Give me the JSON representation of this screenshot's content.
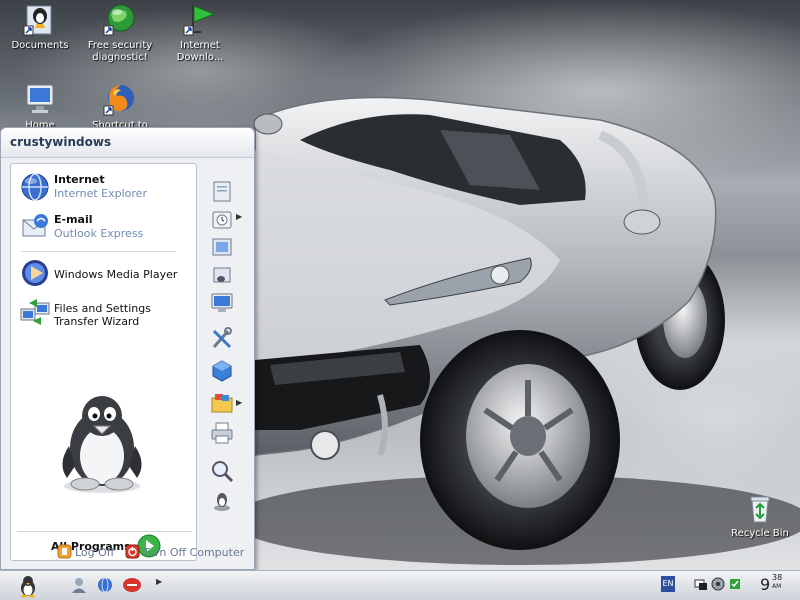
{
  "desktop": {
    "icons": [
      {
        "label": "Documents",
        "icon": "documents-icon"
      },
      {
        "label": "Free security diagnostic!",
        "icon": "security-globe-icon"
      },
      {
        "label": "Internet Downlo...",
        "icon": "download-flag-icon"
      },
      {
        "label": "Home",
        "icon": "computer-monitor-icon"
      },
      {
        "label": "Shortcut to",
        "icon": "firefox-icon"
      },
      {
        "label": "Recycle Bin",
        "icon": "recycle-bin-icon"
      }
    ]
  },
  "start_menu": {
    "user_name": "crustywindows",
    "pinned": [
      {
        "title": "Internet",
        "subtitle": "Internet Explorer"
      },
      {
        "title": "E-mail",
        "subtitle": "Outlook Express"
      }
    ],
    "programs": [
      {
        "label": "Windows Media Player"
      },
      {
        "label": "Files and Settings Transfer Wizard"
      }
    ],
    "all_programs": "All Programs",
    "log_off": "Log Off",
    "turn_off": "Turn Off Computer"
  },
  "taskbar": {
    "language": "EN",
    "clock_hour": "9",
    "clock_minute": "38",
    "clock_ampm": "AM"
  },
  "colors": {
    "accent": "#2d4f9e",
    "subtitle_text": "#6f8bb0",
    "log_off": "#f0a030",
    "turn_off": "#d83a2a"
  }
}
